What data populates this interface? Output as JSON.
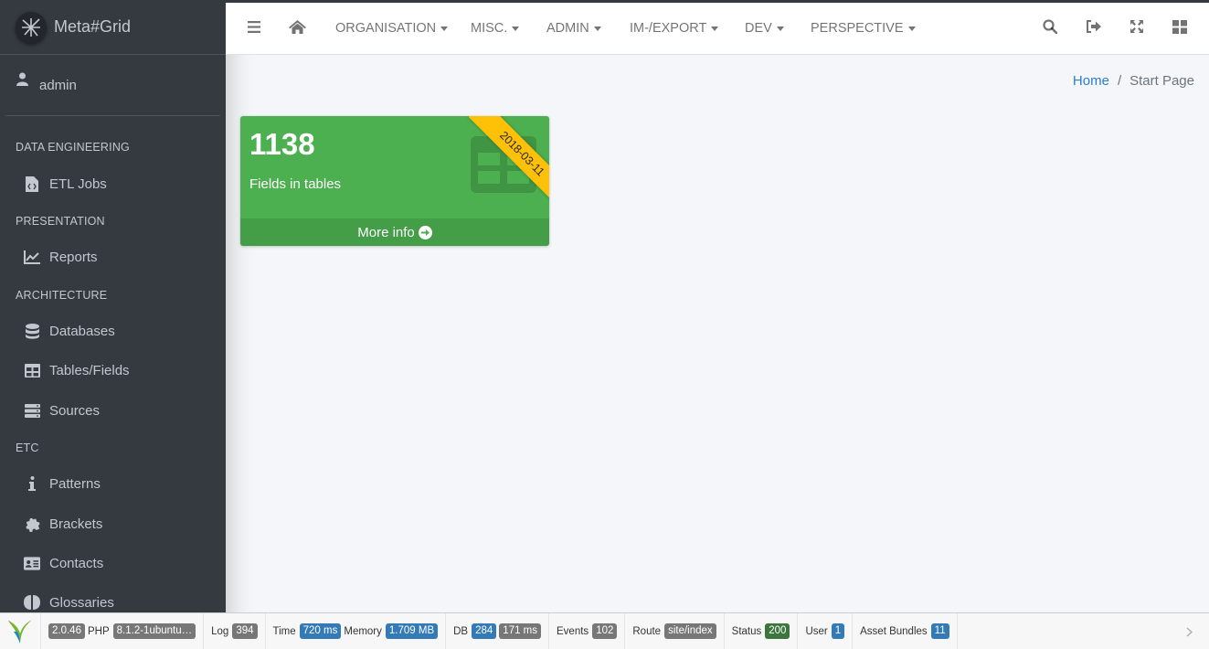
{
  "brand": {
    "title": "Meta#Grid"
  },
  "user": {
    "name": "admin"
  },
  "sidebar": {
    "sections": [
      {
        "header": "DATA ENGINEERING",
        "items": [
          {
            "label": "ETL Jobs",
            "icon": "file-code-icon"
          }
        ]
      },
      {
        "header": "PRESENTATION",
        "items": [
          {
            "label": "Reports",
            "icon": "line-chart-icon"
          }
        ]
      },
      {
        "header": "ARCHITECTURE",
        "items": [
          {
            "label": "Databases",
            "icon": "database-icon"
          },
          {
            "label": "Tables/Fields",
            "icon": "table-icon"
          },
          {
            "label": "Sources",
            "icon": "server-icon"
          }
        ]
      },
      {
        "header": "ETC",
        "items": [
          {
            "label": "Patterns",
            "icon": "info-icon"
          },
          {
            "label": "Brackets",
            "icon": "puzzle-icon"
          },
          {
            "label": "Contacts",
            "icon": "address-card-icon"
          },
          {
            "label": "Glossaries",
            "icon": "brain-icon"
          }
        ]
      }
    ]
  },
  "topnav": {
    "menus": [
      "ORGANISATION",
      "MISC.",
      "ADMIN",
      "IM-/EXPORT",
      "DEV",
      "PERSPECTIVE"
    ],
    "icons": [
      "bars-icon",
      "home-icon",
      "search-icon",
      "sign-out-icon",
      "expand-icon",
      "grid-icon"
    ]
  },
  "breadcrumb": {
    "home": "Home",
    "separator": "/",
    "current": "Start Page"
  },
  "smallbox": {
    "value": "1138",
    "label": "Fields in tables",
    "ribbon": "2018-03-11",
    "footer": "More info",
    "color": "#4caf50",
    "ribbon_color": "#ffc107"
  },
  "debugbar": {
    "version": "2.0.46",
    "php_label": "PHP",
    "php_version": "8.1.2-1ubuntu…",
    "log_label": "Log",
    "log_count": "394",
    "time_label": "Time",
    "time_value": "720 ms",
    "memory_label": "Memory",
    "memory_value": "1.709 MB",
    "db_label": "DB",
    "db_count": "284",
    "db_time": "171 ms",
    "events_label": "Events",
    "events_count": "102",
    "route_label": "Route",
    "route_value": "site/index",
    "status_label": "Status",
    "status_value": "200",
    "user_label": "User",
    "user_value": "1",
    "assets_label": "Asset Bundles",
    "assets_value": "11"
  }
}
